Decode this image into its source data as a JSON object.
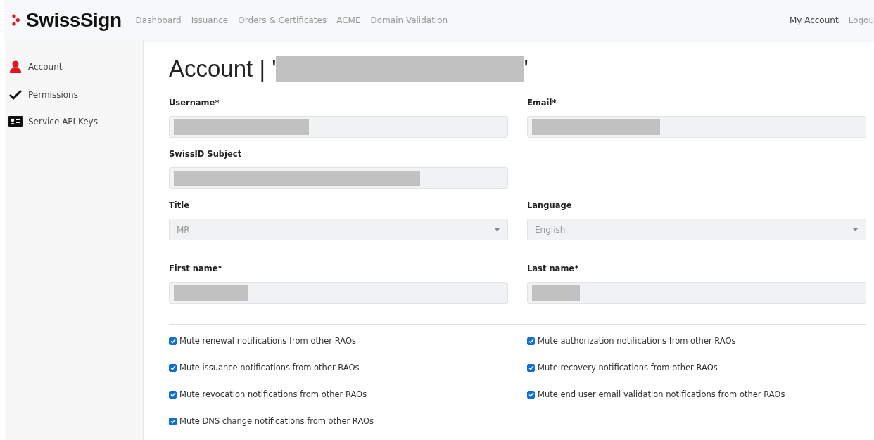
{
  "brand": {
    "name": "SwissSign"
  },
  "nav": [
    {
      "label": "Dashboard"
    },
    {
      "label": "Issuance"
    },
    {
      "label": "Orders & Certificates"
    },
    {
      "label": "ACME"
    },
    {
      "label": "Domain Validation"
    }
  ],
  "user_nav": [
    {
      "label": "My Account",
      "selected": true
    },
    {
      "label": "Logou",
      "selected": false
    }
  ],
  "sidebar": {
    "items": [
      {
        "label": "Account",
        "kind": "person"
      },
      {
        "label": "Permissions",
        "kind": "check"
      },
      {
        "label": "Service API Keys",
        "kind": "card"
      }
    ]
  },
  "page": {
    "title": "Account | '",
    "title_end": "'",
    "title_redacted": true
  },
  "fields": [
    {
      "label": "Username*",
      "kind": "text",
      "redacted": true
    },
    {
      "label": "Email*",
      "kind": "text",
      "redacted": true
    },
    {
      "label": "SwissID Subject",
      "kind": "text",
      "redacted": true
    },
    {
      "kind": "spacer"
    },
    {
      "label": "Title",
      "kind": "select",
      "value": "MR"
    },
    {
      "label": "Language",
      "kind": "select",
      "value": "English"
    },
    {
      "label": "First name*",
      "kind": "text",
      "redacted": true
    },
    {
      "label": "Last name*",
      "kind": "text",
      "redacted": true
    }
  ],
  "checkboxes": [
    {
      "label": "Mute renewal notifications from other RAOs",
      "checked": true
    },
    {
      "label": "Mute authorization notifications from other RAOs",
      "checked": true
    },
    {
      "label": "Mute issuance notifications from other RAOs",
      "checked": true
    },
    {
      "label": "Mute recovery notifications from other RAOs",
      "checked": true
    },
    {
      "label": "Mute revocation notifications from other RAOs",
      "checked": true
    },
    {
      "label": "Mute end user email validation notifications from other RAOs",
      "checked": true
    },
    {
      "label": "Mute DNS change notifications from other RAOs",
      "checked": true
    }
  ]
}
